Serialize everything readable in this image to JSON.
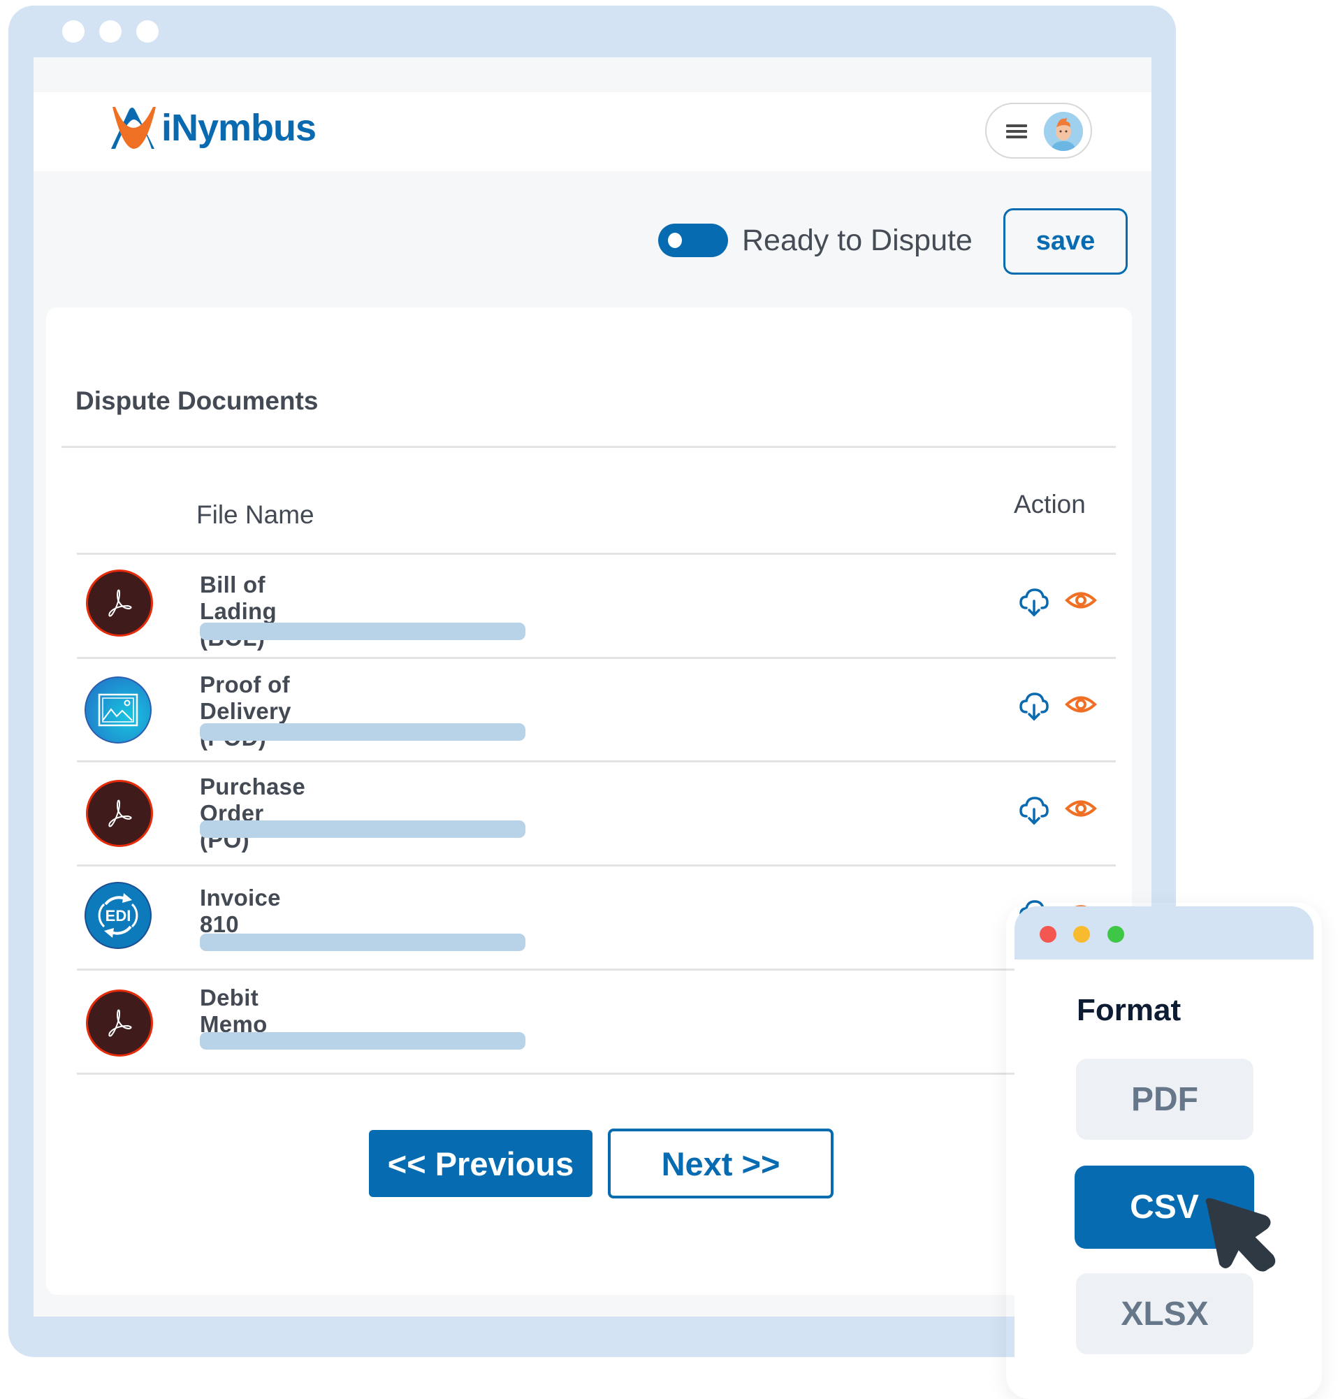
{
  "app": {
    "brand": "iNymbus"
  },
  "header": {
    "menu_icon": "hamburger-icon",
    "avatar": "user-avatar"
  },
  "toolbar": {
    "toggle_label": "Ready to Dispute",
    "toggle_on": true,
    "save_label": "save"
  },
  "card": {
    "title": "Dispute Documents",
    "columns": {
      "file_name": "File Name",
      "action": "Action"
    },
    "rows": [
      {
        "title": "Bill of Lading (BOL)",
        "icon": "pdf-icon",
        "actions": [
          "cloud-download-icon",
          "eye-icon"
        ]
      },
      {
        "title": "Proof of Delivery (POD)",
        "icon": "image-file-icon",
        "actions": [
          "cloud-download-icon",
          "eye-icon"
        ]
      },
      {
        "title": "Purchase Order (PO)",
        "icon": "pdf-icon",
        "actions": [
          "cloud-download-icon",
          "eye-icon"
        ]
      },
      {
        "title": "Invoice 810",
        "icon": "edi-icon",
        "actions": [
          "cloud-download-icon",
          "eye-icon"
        ]
      },
      {
        "title": "Debit Memo",
        "icon": "pdf-icon",
        "actions": []
      }
    ]
  },
  "pagination": {
    "previous_label": "<< Previous",
    "next_label": "Next >>"
  },
  "format_popup": {
    "title": "Format",
    "options": [
      "PDF",
      "CSV",
      "XLSX"
    ],
    "selected": "CSV"
  },
  "colors": {
    "primary": "#066bb0",
    "frame": "#d3e3f4",
    "eye_icon": "#f06f24",
    "pdf_icon_bg": "#3f1b1b",
    "pdf_icon_border": "#e62b0a",
    "mac_red": "#f4574f",
    "mac_yellow": "#f8bb2f",
    "mac_green": "#3ec746"
  }
}
